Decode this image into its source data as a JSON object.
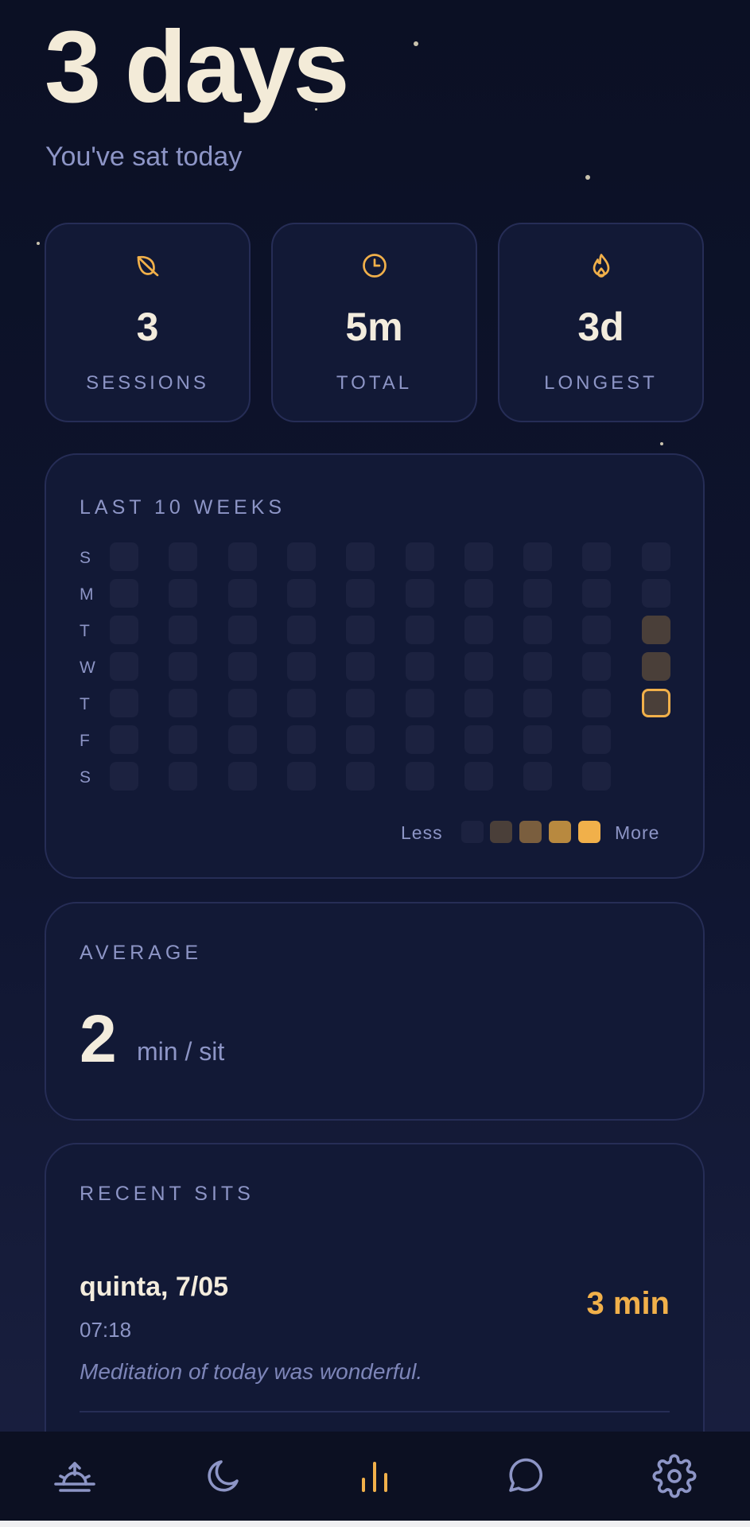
{
  "header": {
    "streak": "3 days",
    "subtitle": "You've sat today"
  },
  "stats": [
    {
      "icon": "leaf-icon",
      "value": "3",
      "label": "SESSIONS"
    },
    {
      "icon": "clock-icon",
      "value": "5m",
      "label": "TOTAL"
    },
    {
      "icon": "flame-icon",
      "value": "3d",
      "label": "LONGEST"
    }
  ],
  "heatmap": {
    "title": "LAST 10 WEEKS",
    "day_labels": [
      "S",
      "M",
      "T",
      "W",
      "T",
      "F",
      "S"
    ],
    "weeks": 10,
    "levels": [
      [
        0,
        0,
        0,
        0,
        0,
        0,
        0
      ],
      [
        0,
        0,
        0,
        0,
        0,
        0,
        0
      ],
      [
        0,
        0,
        0,
        0,
        0,
        0,
        0
      ],
      [
        0,
        0,
        0,
        0,
        0,
        0,
        0
      ],
      [
        0,
        0,
        0,
        0,
        0,
        0,
        0
      ],
      [
        0,
        0,
        0,
        0,
        0,
        0,
        0
      ],
      [
        0,
        0,
        0,
        0,
        0,
        0,
        0
      ],
      [
        0,
        0,
        0,
        0,
        0,
        0,
        0
      ],
      [
        0,
        0,
        0,
        0,
        0,
        0,
        0
      ],
      [
        0,
        0,
        1,
        1,
        1,
        null,
        null
      ]
    ],
    "today": {
      "week": 9,
      "day": 4
    },
    "legend_less": "Less",
    "legend_more": "More",
    "level_colors": [
      "#1c2240",
      "#4a3f39",
      "#7a5e3e",
      "#b8893f",
      "#f1b04a"
    ]
  },
  "average": {
    "title": "AVERAGE",
    "value": "2",
    "unit": "min / sit"
  },
  "recent": {
    "title": "RECENT SITS",
    "items": [
      {
        "date": "quinta, 7/05",
        "time": "07:18",
        "note": "Meditation of today was wonderful.",
        "duration": "3 min"
      }
    ]
  },
  "nav": [
    {
      "icon": "sunrise-icon",
      "active": false
    },
    {
      "icon": "moon-icon",
      "active": false
    },
    {
      "icon": "stats-icon",
      "active": true
    },
    {
      "icon": "chat-icon",
      "active": false
    },
    {
      "icon": "gear-icon",
      "active": false
    }
  ],
  "colors": {
    "accent": "#f1b04a",
    "muted": "#8d95c6",
    "card_bg": "#121936",
    "nav_icon": "#8d95c6"
  }
}
